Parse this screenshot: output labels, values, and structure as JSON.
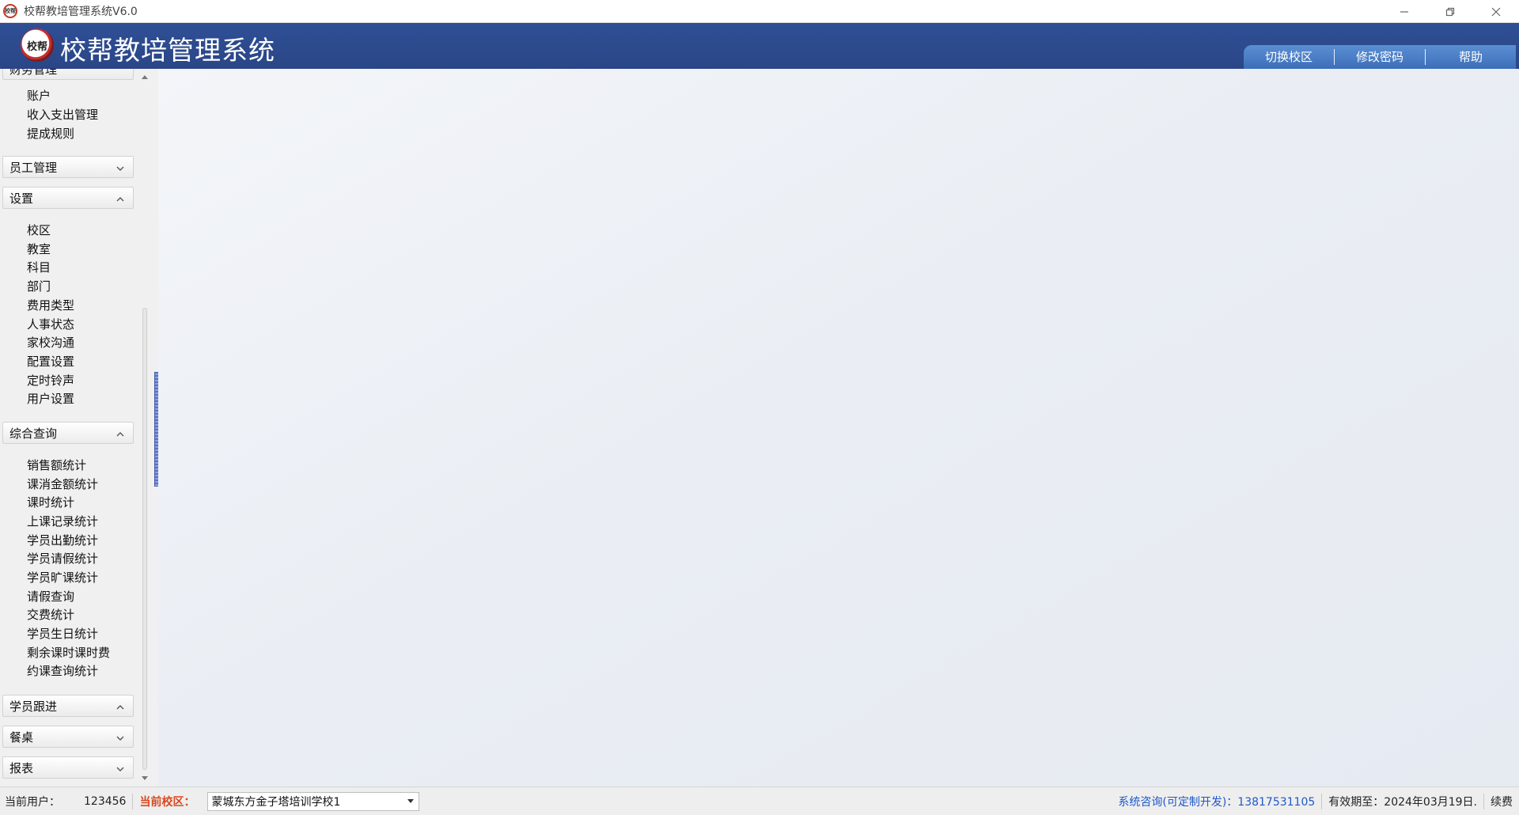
{
  "window": {
    "title": "校帮教培管理系统V6.0",
    "logo_text": "校帮"
  },
  "header": {
    "logo_text": "校帮",
    "title": "校帮教培管理系统",
    "menu": [
      "切换校区",
      "修改密码",
      "帮助"
    ]
  },
  "sidebar": {
    "partial_group": "财务管理",
    "finance_items": [
      "账户",
      "收入支出管理",
      "提成规则"
    ],
    "groups": {
      "staff": "员工管理",
      "settings": "设置",
      "query": "综合查询",
      "followup": "学员跟进",
      "meal": "餐桌",
      "report": "报表"
    },
    "settings_items": [
      "校区",
      "教室",
      "科目",
      "部门",
      "费用类型",
      "人事状态",
      "家校沟通",
      "配置设置",
      "定时铃声",
      "用户设置"
    ],
    "query_items": [
      "销售额统计",
      "课消金额统计",
      "课时统计",
      "上课记录统计",
      "学员出勤统计",
      "学员请假统计",
      "学员旷课统计",
      "请假查询",
      "交费统计",
      "学员生日统计",
      "剩余课时课时费",
      "约课查询统计"
    ]
  },
  "statusbar": {
    "user_label": "当前用户：",
    "user_value": "123456",
    "campus_label": "当前校区：",
    "campus_value": "蒙城东方金子塔培训学校1",
    "contact": "系统咨询(可定制开发)：13817531105",
    "expire": "有效期至：2024年03月19日.",
    "renew": "续费"
  },
  "colors": {
    "header_bg": "#2f4f95",
    "menu_bg": "#4a7fc8",
    "campus_label": "#d9481f",
    "contact_link": "#1f58c9"
  }
}
